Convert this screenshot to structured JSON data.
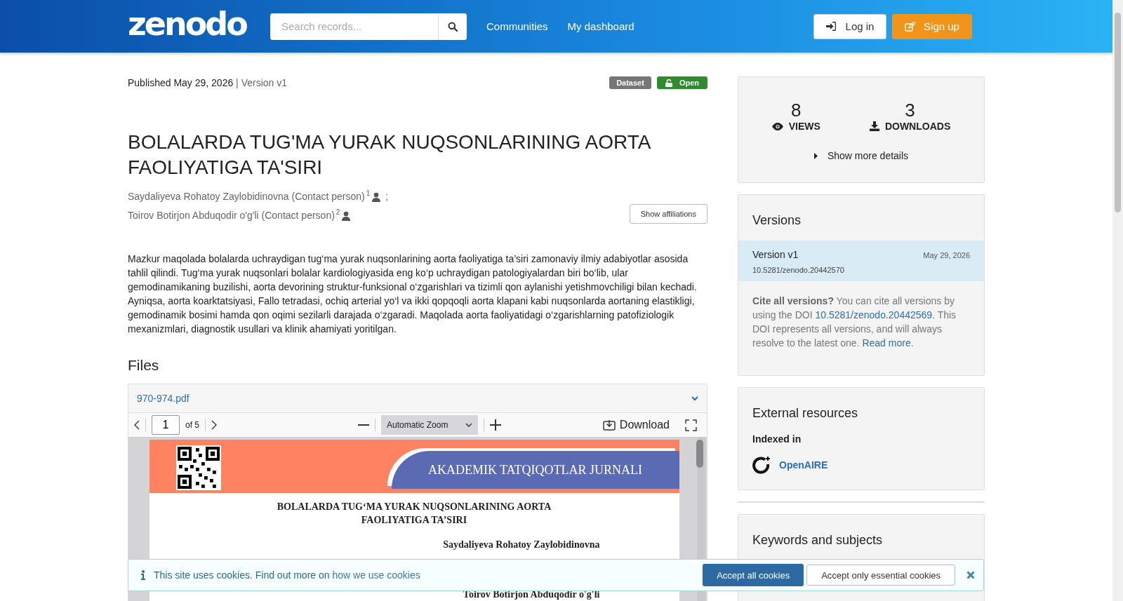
{
  "header": {
    "logo": "zenodo",
    "search": {
      "placeholder": "Search records..."
    },
    "nav": [
      "Communities",
      "My dashboard"
    ],
    "login": "Log in",
    "signup": "Sign up"
  },
  "record": {
    "published": "Published May 29, 2026",
    "version": "| Version v1",
    "badges": [
      {
        "label": "Dataset",
        "kind": "type"
      },
      {
        "label": "Open",
        "kind": "access"
      }
    ],
    "title": "BOLALARDA TUG'MA YURAK NUQSONLARINING AORTA FAOLIYATIGA TA'SIRI",
    "creators": [
      {
        "name": "Saydaliyeva Rohatoy Zaylobidinovna (Contact person)",
        "affiliation": "1",
        "separator": ";"
      },
      {
        "name": "Toirov Botirjon Abduqodir o'g'li (Contact person)",
        "affiliation": "2"
      }
    ],
    "show_affiliations": "Show affiliations",
    "abstract": "Mazkur maqolada bolalarda uchraydigan tug‘ma yurak nuqsonlarining aorta faoliyatiga ta’siri zamonaviy ilmiy adabiyotlar asosida tahlil qilindi. Tug‘ma yurak nuqsonlari bolalar kardiologiyasida eng ko‘p uchraydigan patologiyalardan biri bo‘lib, ular gemodinamikaning buzilishi, aorta devorining struktur-funksional o‘zgarishlari va tizimli qon aylanishi yetishmovchiligi bilan kechadi. Ayniqsa, aorta koarktatsiyasi, Fallo tetradasi, ochiq arterial yo‘l va ikki qopqoqli aorta klapani kabi nuqsonlarda aortaning elastikligi, gemodinamik bosimi hamda qon oqimi sezilarli darajada o‘zgaradi. Maqolada aorta faoliyatidagi o‘zgarishlarning patofiziologik mexanizmlari, diagnostik usullari va klinik ahamiyati yoritilgan.",
    "files_heading": "Files"
  },
  "file_preview": {
    "filename": "970-974.pdf",
    "page": "1",
    "page_count": "of 5",
    "zoom": "Automatic Zoom",
    "download": "Download",
    "document": {
      "journal": "AKADEMIK TATQIQOTLAR JURNALI",
      "title_lines": [
        "BOLALARDA TUG‘MA YURAK NUQSONLARINING AORTA",
        "FAOLIYATIGA TA’SIRI"
      ],
      "authors": [
        "Saydaliyeva Rohatoy Zaylobidinovna",
        "Toirov Botirjon Abduqodir o'g'li"
      ]
    }
  },
  "stats": {
    "items": [
      {
        "value": "8",
        "label": "VIEWS",
        "kind": "views"
      },
      {
        "value": "3",
        "label": "DOWNLOADS",
        "kind": "downloads"
      }
    ],
    "show_more": "Show more details"
  },
  "versions": {
    "heading": "Versions",
    "items": [
      {
        "label": "Version v1",
        "date": "May 29, 2026",
        "doi": "10.5281/zenodo.20442570",
        "selected": true
      }
    ],
    "cite_intro": "**Cite all versions?** You can cite all versions by using the DOI ",
    "cite_doi": "10.5281/zenodo.20442569",
    "cite_mid": ". This DOI represents all versions, and will always resolve to the latest one. ",
    "read_more": "Read more",
    "cite_end": "."
  },
  "external": {
    "heading": "External resources",
    "subheading": "Indexed in",
    "links": [
      "OpenAIRE"
    ]
  },
  "keywords": {
    "heading": "Keywords and subjects"
  },
  "cookie_banner": {
    "text": "This site uses cookies. Find out more on ",
    "link": "how we use cookies",
    "accept_all": "Accept all cookies",
    "accept_essential": "Accept only essential cookies"
  }
}
